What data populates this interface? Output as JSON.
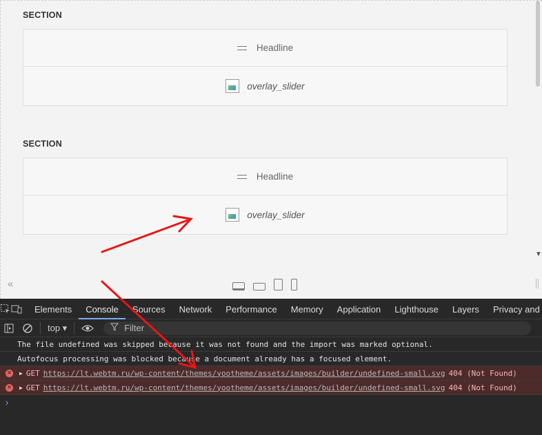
{
  "builder": {
    "sections": [
      {
        "label": "SECTION",
        "rows": [
          {
            "icon": "headline-icon",
            "text": "Headline"
          },
          {
            "icon": "image-icon",
            "text": "overlay_slider"
          }
        ]
      },
      {
        "label": "SECTION",
        "rows": [
          {
            "icon": "headline-icon",
            "text": "Headline"
          },
          {
            "icon": "image-icon",
            "text": "overlay_slider"
          }
        ]
      }
    ],
    "collapse_glyph": "«",
    "devices": [
      "desktop-icon",
      "laptop-icon",
      "tablet-icon",
      "phone-icon"
    ]
  },
  "devtools": {
    "tabs": [
      "Elements",
      "Console",
      "Sources",
      "Network",
      "Performance",
      "Memory",
      "Application",
      "Lighthouse",
      "Layers",
      "Privacy and"
    ],
    "active_tab": "Console",
    "context": "top ▾",
    "filter_placeholder": "Filter",
    "messages": [
      {
        "type": "info",
        "text": "The file undefined was skipped because it was not found and the import was marked optional."
      },
      {
        "type": "info",
        "text": "Autofocus processing was blocked because a document already has a focused element."
      },
      {
        "type": "error",
        "method": "GET",
        "url": "https://lt.webtm.ru/wp-content/themes/yootheme/assets/images/builder/undefined-small.svg",
        "status": "404 (Not Found)"
      },
      {
        "type": "error",
        "method": "GET",
        "url": "https://lt.webtm.ru/wp-content/themes/yootheme/assets/images/builder/undefined-small.svg",
        "status": "404 (Not Found)"
      }
    ],
    "prompt": "›"
  },
  "colors": {
    "annotation_arrow": "#e81515",
    "active_tab_underline": "#7cacf8",
    "error_bg": "#4e2b2b"
  }
}
